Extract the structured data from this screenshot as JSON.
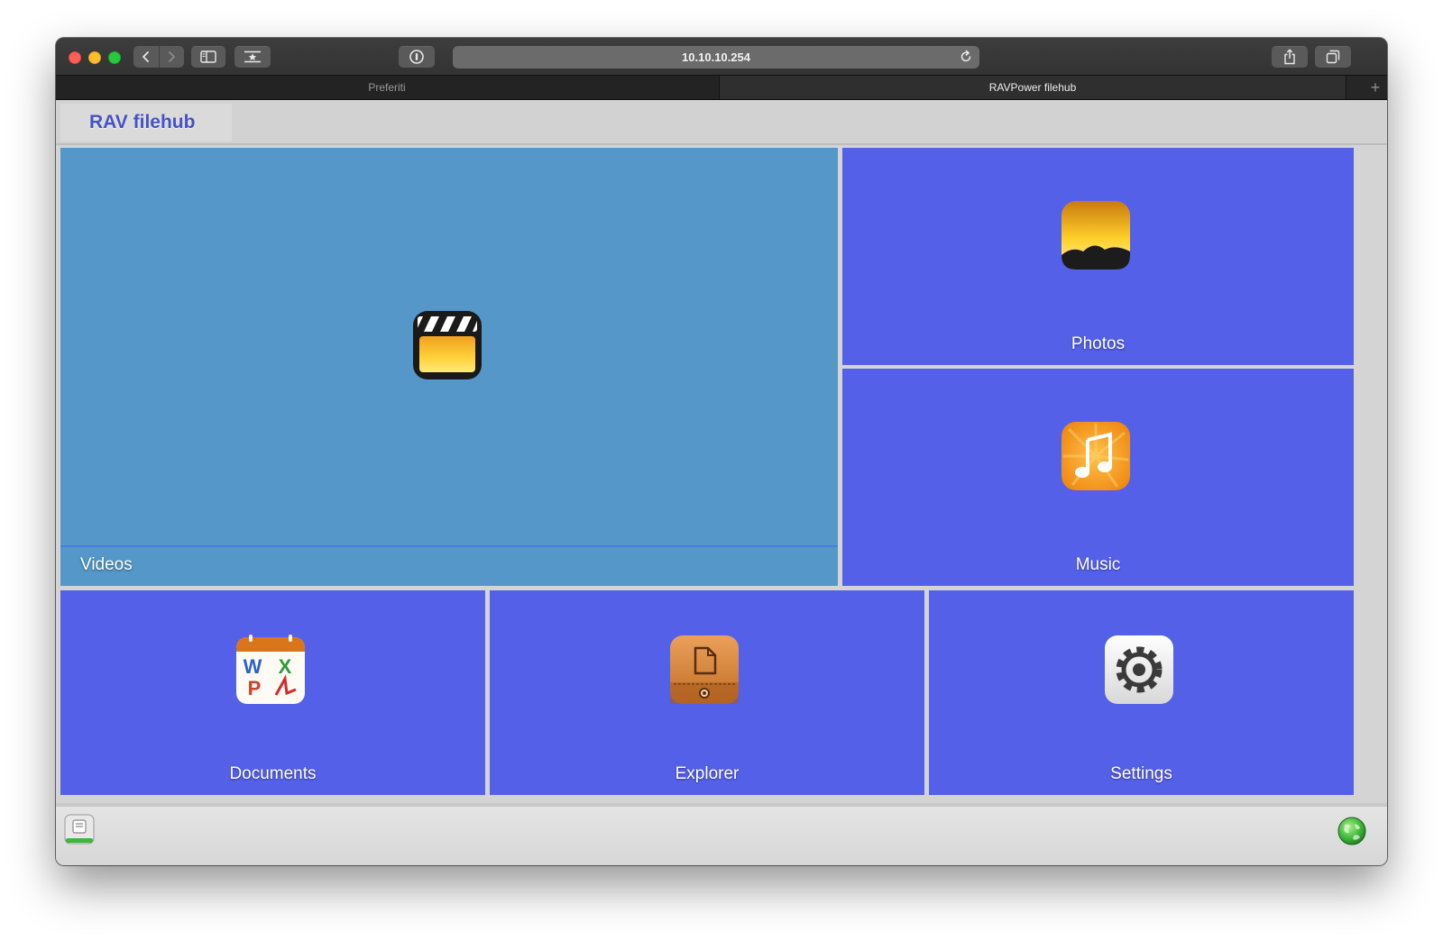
{
  "browser": {
    "url": "10.10.10.254",
    "tabs": [
      {
        "label": "Preferiti"
      },
      {
        "label": "RAVPower filehub"
      }
    ],
    "new_tab_glyph": "+"
  },
  "app": {
    "brand": "RAV filehub",
    "tiles": {
      "videos": {
        "label": "Videos",
        "icon": "clapperboard-icon"
      },
      "photos": {
        "label": "Photos",
        "icon": "sunset-photo-icon"
      },
      "music": {
        "label": "Music",
        "icon": "music-note-icon"
      },
      "documents": {
        "label": "Documents",
        "icon": "office-documents-icon"
      },
      "explorer": {
        "label": "Explorer",
        "icon": "file-explorer-icon"
      },
      "settings": {
        "label": "Settings",
        "icon": "gear-icon"
      }
    },
    "footer": {
      "left_icon": "storage-icon",
      "right_icon": "network-globe-icon"
    }
  },
  "colors": {
    "tile_primary": "#5560e9",
    "tile_video": "#5497c8",
    "brand_text": "#4651c4"
  }
}
